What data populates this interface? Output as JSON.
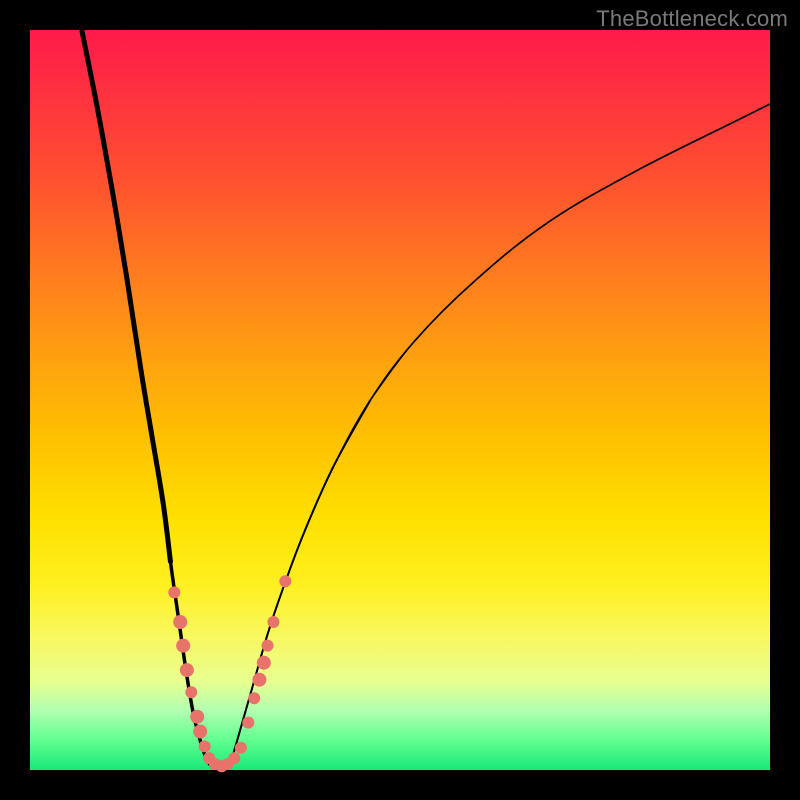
{
  "watermark": "TheBottleneck.com",
  "chart_data": {
    "type": "line",
    "title": "",
    "xlabel": "",
    "ylabel": "",
    "xlim": [
      0,
      100
    ],
    "ylim": [
      0,
      100
    ],
    "grid": false,
    "legend": false,
    "series": [
      {
        "name": "left-curve",
        "stroke_width_start": 5,
        "stroke_width_end": 2,
        "x": [
          7,
          9,
          11,
          13,
          15,
          16.5,
          18,
          19,
          20,
          21,
          22,
          23,
          24,
          25.2
        ],
        "y": [
          100,
          90,
          79,
          67,
          54,
          45,
          36,
          28,
          21,
          14,
          8,
          4,
          1.2,
          0
        ]
      },
      {
        "name": "right-curve",
        "stroke_width_start": 2,
        "stroke_width_end": 1.3,
        "x": [
          26.8,
          28,
          30,
          32,
          34,
          37,
          41,
          46,
          52,
          60,
          70,
          82,
          96,
          100
        ],
        "y": [
          0,
          4,
          11,
          18,
          24,
          32,
          41,
          50,
          58,
          66,
          74,
          81,
          88,
          90
        ]
      }
    ],
    "scatter": [
      {
        "name": "left-cluster",
        "color": "#e8736b",
        "points": [
          {
            "x": 19.5,
            "y": 24,
            "r": 6
          },
          {
            "x": 20.3,
            "y": 20,
            "r": 7
          },
          {
            "x": 20.7,
            "y": 16.8,
            "r": 7
          },
          {
            "x": 21.2,
            "y": 13.5,
            "r": 7
          },
          {
            "x": 21.8,
            "y": 10.5,
            "r": 6
          },
          {
            "x": 22.6,
            "y": 7.2,
            "r": 7
          },
          {
            "x": 23.0,
            "y": 5.2,
            "r": 7
          },
          {
            "x": 23.6,
            "y": 3.2,
            "r": 6
          }
        ]
      },
      {
        "name": "bottom-cluster",
        "color": "#e8736b",
        "points": [
          {
            "x": 24.2,
            "y": 1.6,
            "r": 6
          },
          {
            "x": 25.0,
            "y": 0.8,
            "r": 6
          },
          {
            "x": 25.9,
            "y": 0.5,
            "r": 6
          },
          {
            "x": 26.7,
            "y": 0.8,
            "r": 6
          },
          {
            "x": 27.6,
            "y": 1.6,
            "r": 6
          },
          {
            "x": 28.5,
            "y": 3.0,
            "r": 6
          }
        ]
      },
      {
        "name": "right-cluster",
        "color": "#e8736b",
        "points": [
          {
            "x": 29.5,
            "y": 6.4,
            "r": 6
          },
          {
            "x": 30.3,
            "y": 9.7,
            "r": 6
          },
          {
            "x": 31.0,
            "y": 12.2,
            "r": 7
          },
          {
            "x": 31.6,
            "y": 14.5,
            "r": 7
          },
          {
            "x": 32.1,
            "y": 16.8,
            "r": 6
          },
          {
            "x": 32.9,
            "y": 20.0,
            "r": 6
          },
          {
            "x": 34.5,
            "y": 25.5,
            "r": 6
          }
        ]
      }
    ]
  }
}
